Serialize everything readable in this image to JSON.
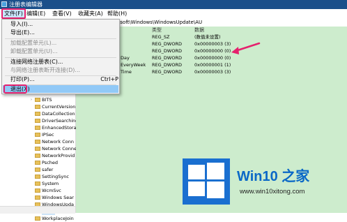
{
  "window": {
    "title": "注册表编辑器"
  },
  "menubar": [
    {
      "label": "文件(F)"
    },
    {
      "label": "编辑(E)"
    },
    {
      "label": "查看(V)"
    },
    {
      "label": "收藏夹(A)"
    },
    {
      "label": "帮助(H)"
    }
  ],
  "address": "osoft\\Windows\\WindowsUpdate\\AU",
  "file_menu": {
    "import": "导入(I)...",
    "export": "导出(E)...",
    "load_hive": "加载配置单元(L)...",
    "unload_hive": "卸载配置单元(U)...",
    "connect": "连接网络注册表(C)...",
    "disconnect": "与网络注册表断开连接(D)...",
    "print": "打印(P)...",
    "print_shortcut": "Ctrl+P",
    "exit": "退出(X)"
  },
  "values_pane": {
    "columns": {
      "type": "类型",
      "data": "数据"
    },
    "rows": [
      {
        "name": "",
        "type": "REG_SZ",
        "data": "(数值未设置)"
      },
      {
        "name": "",
        "type": "REG_DWORD",
        "data": "0x00000003 (3)"
      },
      {
        "name": "",
        "type": "REG_DWORD",
        "data": "0x00000000 (0)"
      },
      {
        "name": "Day",
        "type": "REG_DWORD",
        "data": "0x00000000 (0)"
      },
      {
        "name": "EveryWeek",
        "type": "REG_DWORD",
        "data": "0x00000001 (1)"
      },
      {
        "name": "Time",
        "type": "REG_DWORD",
        "data": "0x00000003 (3)"
      }
    ]
  },
  "tree": [
    {
      "label": "BITS"
    },
    {
      "label": "CurrentVersion"
    },
    {
      "label": "DataCollection"
    },
    {
      "label": "DriverSearching"
    },
    {
      "label": "EnhancedStorage"
    },
    {
      "label": "IPSec"
    },
    {
      "label": "Network Conn"
    },
    {
      "label": "Network Conne"
    },
    {
      "label": "NetworkProvid"
    },
    {
      "label": "Psched"
    },
    {
      "label": "safer"
    },
    {
      "label": "SettingSync"
    },
    {
      "label": "System"
    },
    {
      "label": "WcmSvc"
    },
    {
      "label": "Windows Sear"
    },
    {
      "label": "WindowsUpda"
    },
    {
      "label": "AU"
    },
    {
      "label": "WorkplaceJoin"
    }
  ],
  "watermark": {
    "title": "Win10 之家",
    "url": "www.win10xitong.com"
  },
  "colors": {
    "titlebar": "#1a4f8a",
    "pane_bg": "#cdeccd",
    "highlight_border": "#e5206d",
    "logo_blue": "#1a6fd0"
  }
}
